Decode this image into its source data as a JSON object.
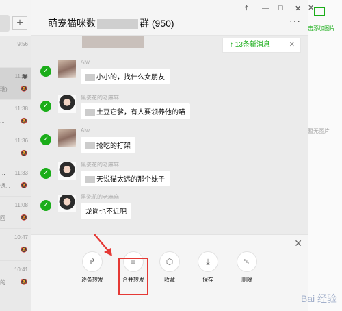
{
  "sidebar": {
    "add_label": "+",
    "conversations": [
      {
        "time": "9:56",
        "line1": "",
        "line2": "",
        "active": false
      },
      {
        "time": "11:38",
        "line1": "群",
        "line2": "瑞)",
        "active": true
      },
      {
        "time": "11:38",
        "line1": "",
        "line2": "...",
        "active": false
      },
      {
        "time": "11:36",
        "line1": "",
        "line2": "",
        "active": false
      },
      {
        "time": "11:33",
        "line1": "…",
        "line2": "诱...",
        "active": false
      },
      {
        "time": "11:08",
        "line1": "",
        "line2": "回",
        "active": false
      },
      {
        "time": "10:47",
        "line1": "",
        "line2": "…",
        "active": false
      },
      {
        "time": "10:41",
        "line1": "",
        "line2": "的...",
        "active": false
      }
    ]
  },
  "header": {
    "title_prefix": "萌宠猫咪数",
    "title_suffix": "群 (950)",
    "pin_icon": "pin-icon",
    "minimize": "—",
    "maximize": "□",
    "close": "✕",
    "more": "···"
  },
  "new_message_bar": {
    "label": "↑ 13条新消息",
    "close": "✕"
  },
  "messages": [
    {
      "sender": "Alw",
      "text": "小小的，找什么女朋友",
      "avatar": "dog"
    },
    {
      "sender": "黑瓷花的老麻麻",
      "text": "土豆它爹，有人要领养他的喵",
      "avatar": "girl"
    },
    {
      "sender": "Alw",
      "text": "抢吃的打架",
      "avatar": "dog"
    },
    {
      "sender": "黑瓷花的老麻麻",
      "text": "天说猫太远的那个妹子",
      "avatar": "girl"
    },
    {
      "sender": "黑瓷花的老麻麻",
      "text": "龙岗也不近吧",
      "avatar": "girl"
    }
  ],
  "actions": {
    "close": "✕",
    "items": [
      {
        "label": "逐条转发",
        "icon": "forward-one-by-one-icon",
        "glyph": "↱"
      },
      {
        "label": "合并转发",
        "icon": "merge-forward-icon",
        "glyph": "≡"
      },
      {
        "label": "收藏",
        "icon": "favorite-cube-icon",
        "glyph": "⬡"
      },
      {
        "label": "保存",
        "icon": "save-download-icon",
        "glyph": "⤓"
      },
      {
        "label": "删除",
        "icon": "delete-trash-icon",
        "glyph": "␡"
      }
    ]
  },
  "right_panel": {
    "add_image_label": "击添加图片",
    "empty_label": "暂无图片",
    "close": "✕"
  },
  "watermark": "Bai 经验",
  "colors": {
    "accent": "#1aad19",
    "highlight": "#e53935"
  }
}
